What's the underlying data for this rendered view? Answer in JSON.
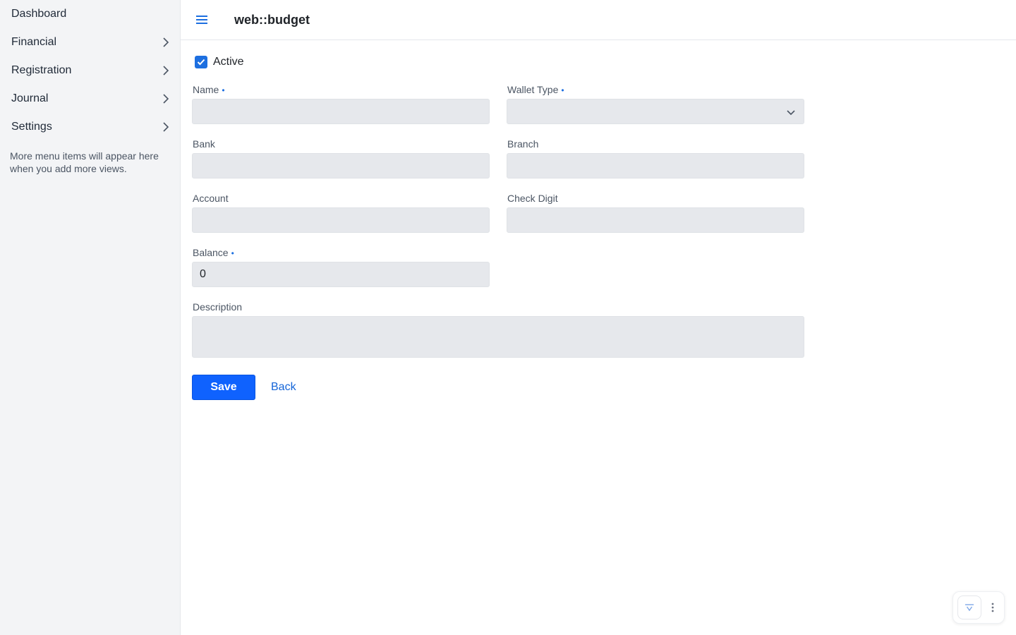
{
  "sidebar": {
    "items": [
      {
        "label": "Dashboard"
      },
      {
        "label": "Financial"
      },
      {
        "label": "Registration"
      },
      {
        "label": "Journal"
      },
      {
        "label": "Settings"
      }
    ],
    "note": "More menu items will appear here when you add more views."
  },
  "header": {
    "title": "web::budget",
    "menu_icon": "hamburger-icon"
  },
  "form": {
    "active_label": "Active",
    "active_checked": true,
    "name": {
      "label": "Name",
      "value": ""
    },
    "wallet_type": {
      "label": "Wallet Type",
      "value": ""
    },
    "bank": {
      "label": "Bank",
      "value": ""
    },
    "branch": {
      "label": "Branch",
      "value": ""
    },
    "account": {
      "label": "Account",
      "value": ""
    },
    "check_digit": {
      "label": "Check Digit",
      "value": ""
    },
    "balance": {
      "label": "Balance",
      "value": "0"
    },
    "description": {
      "label": "Description",
      "value": ""
    },
    "required_marker": "•",
    "save_label": "Save",
    "back_label": "Back"
  },
  "colors": {
    "accent": "#0f62fe",
    "link": "#1565d8",
    "sidebar_bg": "#f3f4f6",
    "input_bg": "#e6e8ec"
  }
}
